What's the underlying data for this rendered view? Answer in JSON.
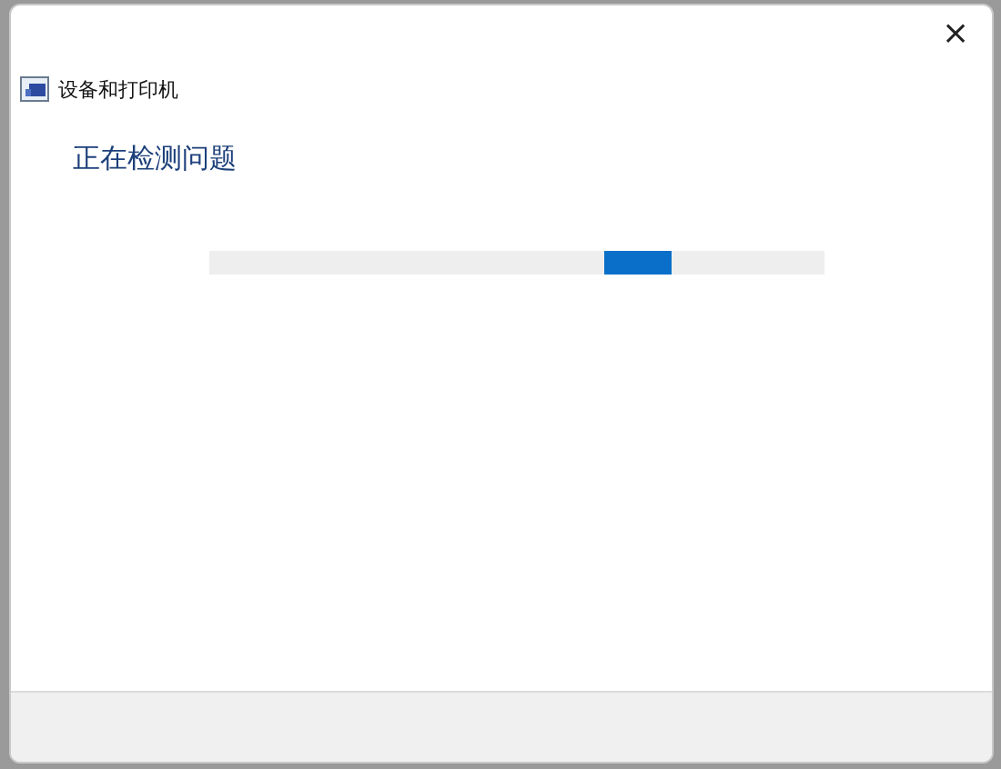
{
  "window": {
    "close": "×"
  },
  "header": {
    "title": "设备和打印机"
  },
  "content": {
    "heading": "正在检测问题"
  },
  "progress": {
    "kind": "marquee",
    "level": 0.75
  }
}
